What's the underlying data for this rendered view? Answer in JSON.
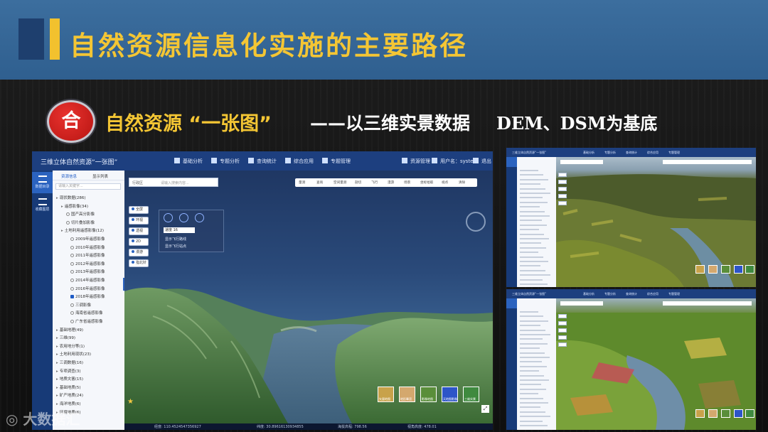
{
  "slide": {
    "title": "自然资源信息化实施的主要路径",
    "badge": "合",
    "subtitle_yellow": "自然资源 “一张图”",
    "subtitle_white": "——以三维实景数据",
    "subtitle_tail": "DEM、DSM为基底",
    "watermark": "大数据汇"
  },
  "app": {
    "title": "三维立体自然资源“一张图”",
    "nav": [
      "基础分析",
      "专题分析",
      "查询统计",
      "综合应用",
      "专题管理"
    ],
    "user": {
      "resource_mgmt": "资源管理",
      "user_label": "用户名：system",
      "logout": "退出"
    },
    "sidebar": [
      "数据目录",
      "收藏图层"
    ],
    "tree": {
      "tab_resources": "资源信息",
      "tab_display": "显示列表",
      "search_placeholder": "请输入关键字...",
      "items": [
        {
          "label": "现状数据(286)",
          "level": 0,
          "kind": "arrow"
        },
        {
          "label": "遥感影像(34)",
          "level": 1,
          "kind": "arrow"
        },
        {
          "label": "国产高分影像",
          "level": 2,
          "kind": "radio"
        },
        {
          "label": "切片叠加影像",
          "level": 2,
          "kind": "radio"
        },
        {
          "label": "土地利用遥感影像(12)",
          "level": 1,
          "kind": "arrow"
        },
        {
          "label": "2009年遥感影像",
          "level": 3,
          "kind": "radio"
        },
        {
          "label": "2010年遥感影像",
          "level": 3,
          "kind": "radio"
        },
        {
          "label": "2011年遥感影像",
          "level": 3,
          "kind": "radio"
        },
        {
          "label": "2012年遥感影像",
          "level": 3,
          "kind": "radio"
        },
        {
          "label": "2013年遥感影像",
          "level": 3,
          "kind": "radio"
        },
        {
          "label": "2014年遥感影像",
          "level": 3,
          "kind": "radio"
        },
        {
          "label": "2016年遥感影像",
          "level": 3,
          "kind": "radio"
        },
        {
          "label": "2018年遥感影像",
          "level": 3,
          "kind": "checked"
        },
        {
          "label": "三调影像",
          "level": 3,
          "kind": "radio"
        },
        {
          "label": "海南省遥感影像",
          "level": 3,
          "kind": "radio"
        },
        {
          "label": "广东省遥感影像",
          "level": 3,
          "kind": "radio"
        },
        {
          "label": "基础地理(49)",
          "level": 0,
          "kind": "arrow"
        },
        {
          "label": "三维(99)",
          "level": 0,
          "kind": "arrow"
        },
        {
          "label": "农用地分等(1)",
          "level": 0,
          "kind": "arrow"
        },
        {
          "label": "土地利用现状(23)",
          "level": 0,
          "kind": "arrow"
        },
        {
          "label": "三调数据(16)",
          "level": 0,
          "kind": "arrow"
        },
        {
          "label": "专项调查(3)",
          "level": 0,
          "kind": "arrow"
        },
        {
          "label": "地质灾害(15)",
          "level": 0,
          "kind": "arrow"
        },
        {
          "label": "基础地质(5)",
          "level": 0,
          "kind": "arrow"
        },
        {
          "label": "矿产地质(24)",
          "level": 0,
          "kind": "arrow"
        },
        {
          "label": "海洋地质(6)",
          "level": 0,
          "kind": "arrow"
        },
        {
          "label": "环境地质(6)",
          "level": 0,
          "kind": "arrow"
        }
      ]
    },
    "map": {
      "search_select": "行政区",
      "search_placeholder": "请输入搜索内容...",
      "toolbar": [
        "量测",
        "查询",
        "空间量测",
        "剖切",
        "飞行",
        "漫游",
        "场景",
        "坐标拾取",
        "视点",
        "清除"
      ],
      "left_buttons": [
        "全屏",
        "环视",
        "透视",
        "2D",
        "漫游",
        "指北针"
      ],
      "flyover": {
        "speed_select": "速度 16",
        "option_1": "显示飞行路线",
        "option_2": "显示飞行站点"
      },
      "basemaps": [
        {
          "label": "矢量地图",
          "color": "#c8a24a"
        },
        {
          "label": "地形晕渲",
          "color": "#d4a86e"
        },
        {
          "label": "影像地图",
          "color": "#5a8e3a"
        },
        {
          "label": "天地图影像",
          "color": "#2d55c8"
        },
        {
          "label": "三维实景",
          "color": "#3f8a3f"
        }
      ]
    },
    "status": {
      "lon": "经度: 110.4524547356927",
      "lat": "纬度: 30.89616130934855",
      "elevation": "海拔高程: 798.56",
      "view_height": "视角高度: 478.01"
    }
  }
}
